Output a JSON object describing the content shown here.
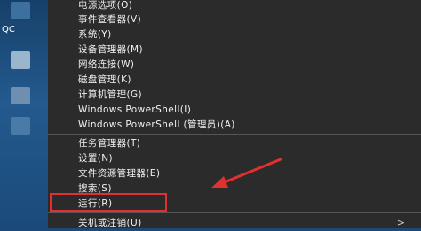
{
  "desktop": {
    "icon_label": "QC"
  },
  "menu": {
    "items": [
      {
        "label": "电源选项(O)"
      },
      {
        "label": "事件查看器(V)"
      },
      {
        "label": "系统(Y)"
      },
      {
        "label": "设备管理器(M)"
      },
      {
        "label": "网络连接(W)"
      },
      {
        "label": "磁盘管理(K)"
      },
      {
        "label": "计算机管理(G)"
      },
      {
        "label": "Windows PowerShell(I)"
      },
      {
        "label": "Windows PowerShell (管理员)(A)"
      },
      {
        "label": "任务管理器(T)"
      },
      {
        "label": "设置(N)"
      },
      {
        "label": "文件资源管理器(E)"
      },
      {
        "label": "搜索(S)"
      },
      {
        "label": "运行(R)"
      },
      {
        "label": "关机或注销(U)",
        "submenu_arrow": ">"
      }
    ]
  },
  "annotation": {
    "highlight_color": "#e0302f"
  }
}
